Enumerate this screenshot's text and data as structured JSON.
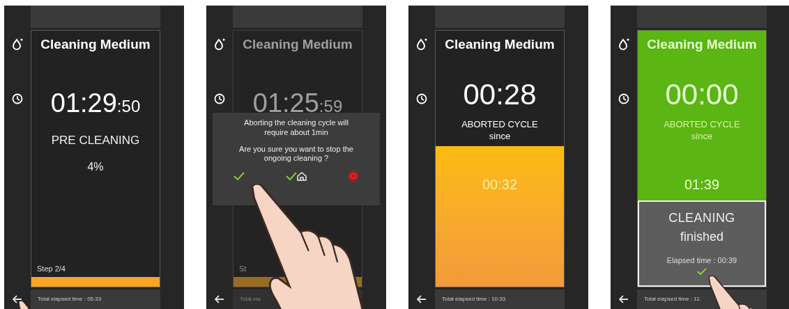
{
  "screens": [
    {
      "kind": "running",
      "dimmed": false,
      "touched": true,
      "title": "Cleaning Medium",
      "timer": "01:29",
      "timer_seconds": ":50",
      "phase": "PRE CLEANING",
      "percent": "4%",
      "step": "Step 2/4",
      "level": 1,
      "total": "Total elapsed time : 05:33"
    },
    {
      "kind": "running",
      "dimmed": true,
      "touched": true,
      "title": "Cleaning Medium",
      "timer": "01:25",
      "timer_seconds": ":59",
      "step": "St",
      "level": 1,
      "total": "Total ela",
      "dialog": {
        "message": "Aborting the cleaning cycle will require about 1min",
        "question": "Are you sure you want to stop the ongoing cleaning ?"
      }
    },
    {
      "kind": "aborted",
      "finished": false,
      "touched": false,
      "title": "Cleaning Medium",
      "timer": "00:28",
      "phase": "ABORTED CYCLE",
      "since": "since",
      "countdown": "00:32",
      "total": "Total elapsed time : 10:33"
    },
    {
      "kind": "aborted",
      "finished": true,
      "touched": true,
      "title": "Cleaning Medium",
      "timer": "00:00",
      "phase": "ABORTED CYCLE",
      "since": "since",
      "countdown": "01:39",
      "total": "Total elapsed time : 11:",
      "result": {
        "heading": "CLEANING",
        "subheading": "finished",
        "elapsed": "Elapsed time : 00:39"
      }
    }
  ]
}
